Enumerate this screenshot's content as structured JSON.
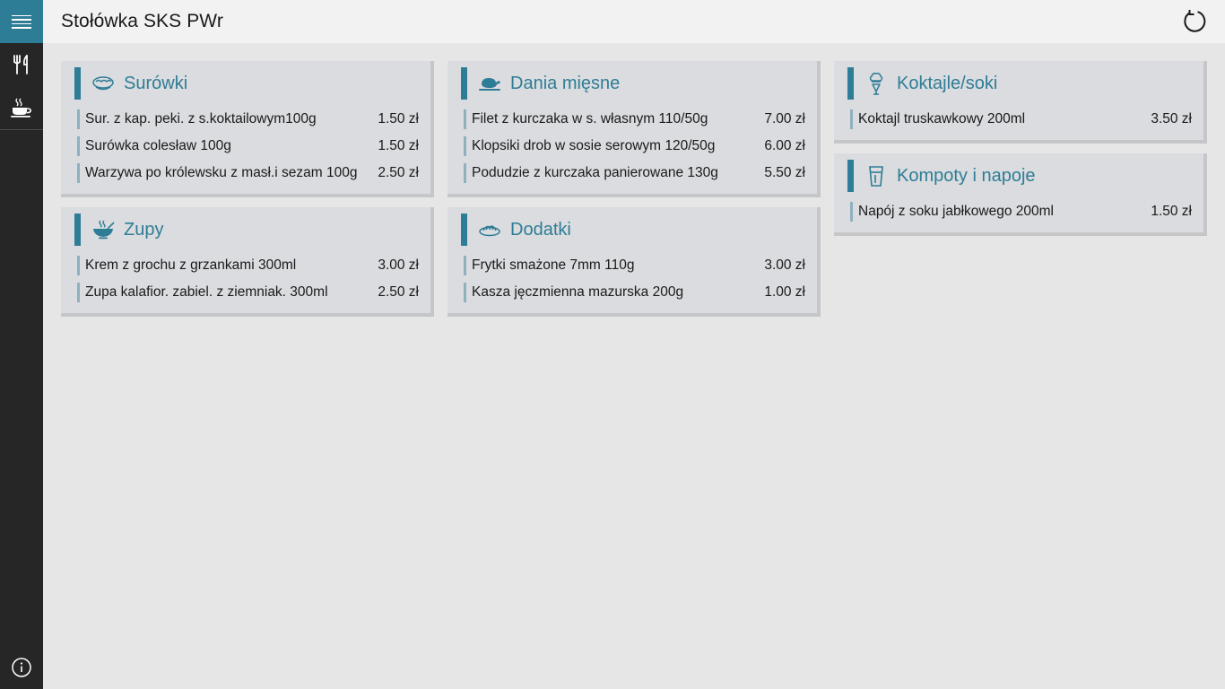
{
  "app": {
    "title": "Stołówka SKS PWr"
  },
  "nav": {
    "menu_icon": "hamburger-icon",
    "items": [
      {
        "icon": "cutlery-icon"
      },
      {
        "icon": "coffee-cup-icon"
      }
    ],
    "bottom": {
      "icon": "info-icon"
    }
  },
  "header": {
    "refresh_icon": "refresh-icon"
  },
  "colors": {
    "accent": "#2e7d96",
    "rail": "#262626",
    "card": "#dadcdf"
  },
  "categories": [
    {
      "title": "Surówki",
      "icon": "salad-bowl-icon",
      "items": [
        {
          "name": "Sur. z kap. peki. z s.koktailowym100g",
          "price": "1.50 zł"
        },
        {
          "name": "Surówka colesław 100g",
          "price": "1.50 zł"
        },
        {
          "name": "Warzywa po królewsku z masł.i sezam 100g",
          "price": "2.50 zł"
        }
      ]
    },
    {
      "title": "Zupy",
      "icon": "soup-bowl-icon",
      "items": [
        {
          "name": "Krem z grochu z grzankami 300ml",
          "price": "3.00 zł"
        },
        {
          "name": "Zupa kalafior. zabiel. z ziemniak. 300ml",
          "price": "2.50 zł"
        }
      ]
    },
    {
      "title": "Dania mięsne",
      "icon": "roast-chicken-icon",
      "items": [
        {
          "name": "Filet z kurczaka w s. własnym 110/50g",
          "price": "7.00 zł"
        },
        {
          "name": "Klopsiki drob w sosie serowym 120/50g",
          "price": "6.00 zł"
        },
        {
          "name": "Podudzie z kurczaka panierowane 130g",
          "price": "5.50 zł"
        }
      ]
    },
    {
      "title": "Dodatki",
      "icon": "side-dish-icon",
      "items": [
        {
          "name": "Frytki smażone 7mm 110g",
          "price": "3.00 zł"
        },
        {
          "name": "Kasza jęczmienna mazurska 200g",
          "price": "1.00 zł"
        }
      ]
    },
    {
      "title": "Koktajle/soki",
      "icon": "ice-cream-icon",
      "items": [
        {
          "name": "Koktajl truskawkowy 200ml",
          "price": "3.50 zł"
        }
      ]
    },
    {
      "title": "Kompoty i napoje",
      "icon": "drink-glass-icon",
      "items": [
        {
          "name": "Napój z soku jabłkowego 200ml",
          "price": "1.50 zł"
        }
      ]
    }
  ]
}
